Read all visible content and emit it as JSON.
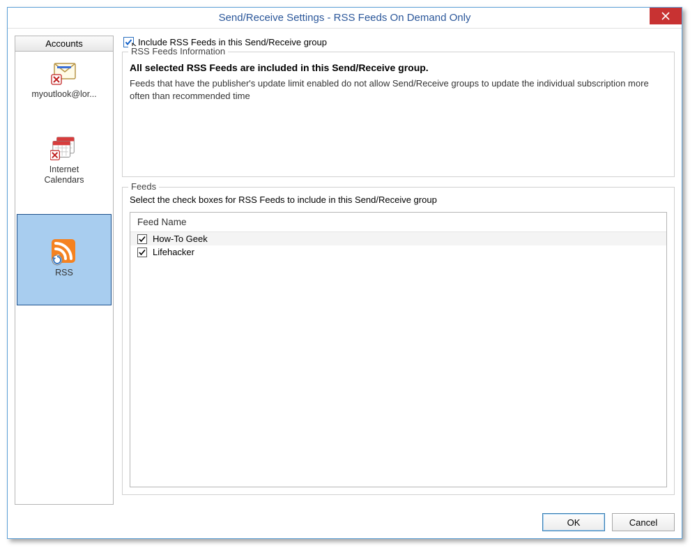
{
  "window": {
    "title": "Send/Receive Settings - RSS Feeds On Demand Only"
  },
  "sidebar": {
    "header": "Accounts",
    "items": [
      {
        "label": "myoutlook@lor...",
        "icon": "envelope-x-icon"
      },
      {
        "label": "Internet Calendars",
        "icon": "calendar-x-icon"
      },
      {
        "label": "RSS",
        "icon": "rss-icon"
      }
    ]
  },
  "include_checkbox": {
    "label": "Include RSS Feeds in this Send/Receive group",
    "checked": true
  },
  "info_group": {
    "legend": "RSS Feeds Information",
    "bold": "All selected RSS Feeds are included in this Send/Receive group.",
    "paragraph": "Feeds that have the publisher's update limit enabled do not allow Send/Receive groups to update the individual subscription more often than recommended time"
  },
  "feeds_group": {
    "legend": "Feeds",
    "instruction": "Select the check boxes for RSS Feeds to include in this Send/Receive group",
    "column_header": "Feed Name",
    "rows": [
      {
        "name": "How-To Geek",
        "checked": true
      },
      {
        "name": "Lifehacker",
        "checked": true
      }
    ]
  },
  "buttons": {
    "ok": "OK",
    "cancel": "Cancel"
  }
}
